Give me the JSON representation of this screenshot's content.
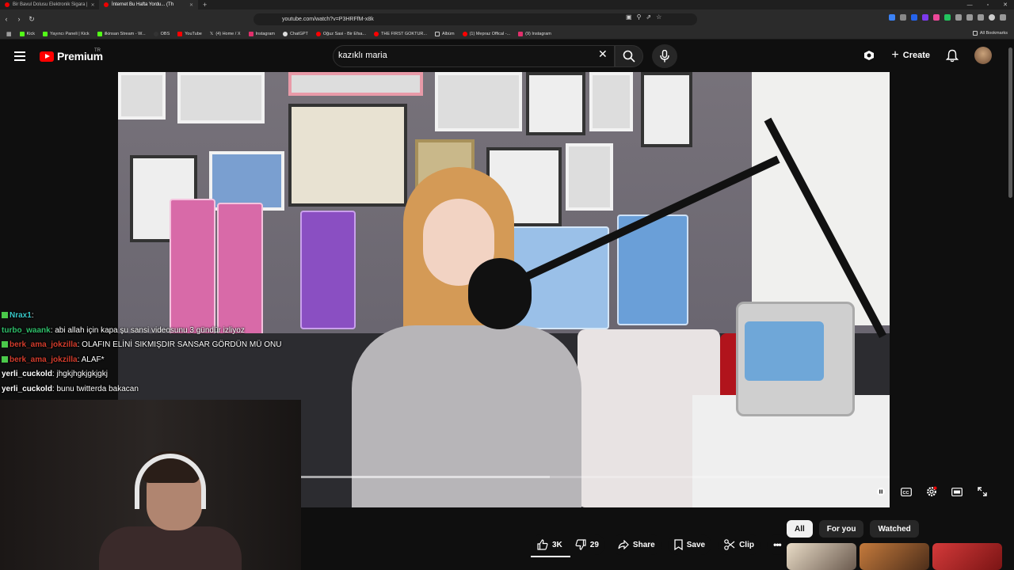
{
  "browser": {
    "tabs": [
      {
        "label": "Bir Bavul Dolusu Elektronik Sigara |",
        "active": false
      },
      {
        "label": "İnternet Bu Hafta Yordu... (Th",
        "active": true
      }
    ],
    "url": "youtube.com/watch?v=P3HRFfM-x8k",
    "bookmarks": [
      "Kick",
      "Yayıncı Paneli | Kick",
      "ilkinsan Stream - W...",
      "OBS",
      "YouTube",
      "(4) Home / X",
      "Instagram",
      "ChatGPT",
      "Oğuz Sasi - Bir Efsa...",
      "THE FIRST GOKTUR...",
      "Albüm",
      "(1) Mepraz Offical -...",
      "(9) Instagram"
    ],
    "bookmarks_all": "All Bookmarks"
  },
  "header": {
    "logo_text": "Premium",
    "logo_region": "TR",
    "search_value": "kazıklı maria",
    "create_label": "Create"
  },
  "video": {
    "progress": 0.56
  },
  "chat": [
    {
      "user": "Nrax1",
      "color": "cyan",
      "text": "",
      "badges": true
    },
    {
      "user": "turbo_waank",
      "color": "green",
      "text": "abi allah için kapa şu sansi videosunu 3 gündür izliyoz",
      "badges": false
    },
    {
      "user": "berk_ama_jokzilla",
      "color": "red",
      "text": "OLAFIN ELİNİ SIKMIŞDIR SANSAR GÖRDÜN MÜ ONU",
      "badges": true
    },
    {
      "user": "berk_ama_jokzilla",
      "color": "red",
      "text": "ALAF*",
      "badges": true
    },
    {
      "user": "yerli_cuckold",
      "color": "white",
      "text": "jhgkjhgkjgkjgkj",
      "badges": false
    },
    {
      "user": "yerli_cuckold",
      "color": "white",
      "text": "bunu twitterda bakacan",
      "badges": false
    }
  ],
  "actions": {
    "likes": "3K",
    "dislikes": "29",
    "share": "Share",
    "save": "Save",
    "clip": "Clip"
  },
  "chips": [
    "All",
    "For you",
    "Watched"
  ]
}
